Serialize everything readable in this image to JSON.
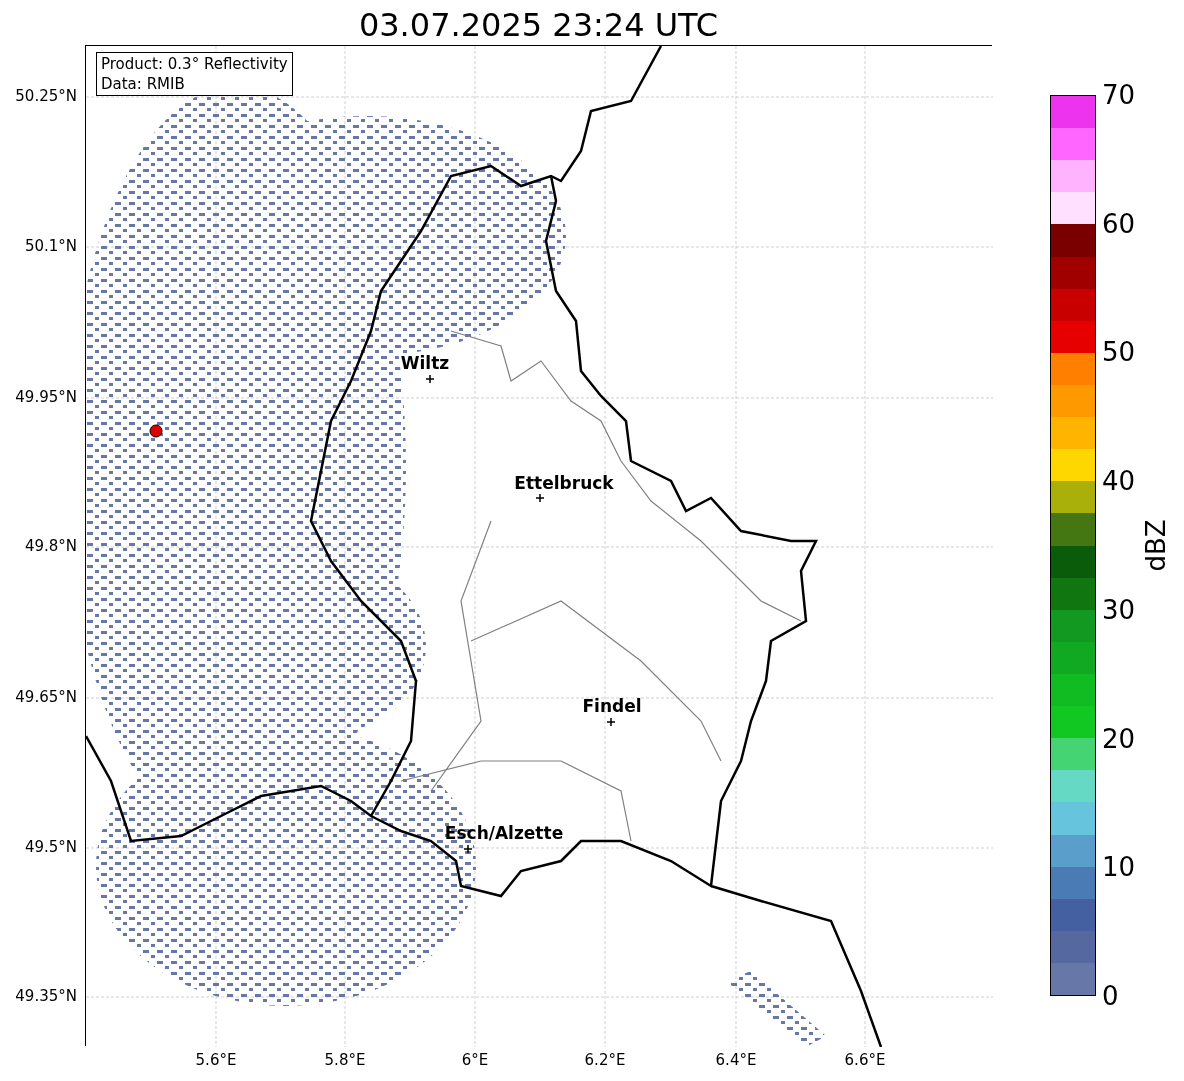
{
  "title": "03.07.2025 23:24 UTC",
  "map": {
    "info_box": [
      "Product: 0.3° Reflectivity",
      "Data: RMIB"
    ],
    "cities": [
      {
        "name": "Wiltz"
      },
      {
        "name": "Ettelbruck"
      },
      {
        "name": "Findel"
      },
      {
        "name": "Esch/Alzette"
      }
    ],
    "y_ticks": [
      "50.25°N",
      "50.1°N",
      "49.95°N",
      "49.8°N",
      "49.65°N",
      "49.5°N",
      "49.35°N"
    ],
    "x_ticks": [
      "5.6°E",
      "5.8°E",
      "6°E",
      "6.2°E",
      "6.4°E",
      "6.6°E"
    ]
  },
  "colorbar": {
    "label": "dBZ",
    "ticks": [
      "70",
      "60",
      "50",
      "40",
      "30",
      "20",
      "10",
      "0"
    ],
    "segments": [
      {
        "color": "#ee33ee"
      },
      {
        "color": "#ff66ff"
      },
      {
        "color": "#ffb3ff"
      },
      {
        "color": "#ffe0ff"
      },
      {
        "color": "#7a0000"
      },
      {
        "color": "#a00000"
      },
      {
        "color": "#c80000"
      },
      {
        "color": "#e60000"
      },
      {
        "color": "#ff7f00"
      },
      {
        "color": "#ff9900"
      },
      {
        "color": "#ffb400"
      },
      {
        "color": "#ffd700"
      },
      {
        "color": "#aab00a"
      },
      {
        "color": "#447711"
      },
      {
        "color": "#0a5c0a"
      },
      {
        "color": "#107710"
      },
      {
        "color": "#119922"
      },
      {
        "color": "#11a822"
      },
      {
        "color": "#11bb22"
      },
      {
        "color": "#11c822"
      },
      {
        "color": "#44d474"
      },
      {
        "color": "#66d9c4"
      },
      {
        "color": "#66c4dc"
      },
      {
        "color": "#5a9fcc"
      },
      {
        "color": "#4a7bb5"
      },
      {
        "color": "#4460a0"
      },
      {
        "color": "#5568a0"
      },
      {
        "color": "#6677a8"
      }
    ]
  }
}
